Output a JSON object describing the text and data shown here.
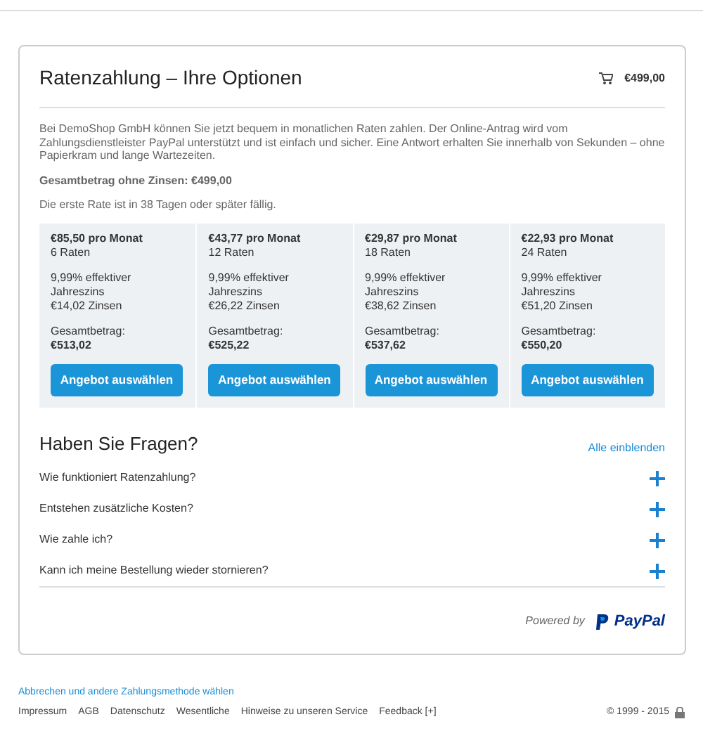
{
  "header": {
    "title": "Ratenzahlung – Ihre Optionen",
    "cart_total": "€499,00"
  },
  "intro": "Bei DemoShop GmbH können Sie jetzt bequem in monatlichen Raten zahlen. Der Online-Antrag wird vom Zahlungsdienstleister PayPal unterstützt und ist einfach und sicher. Eine Antwort erhalten Sie innerhalb von Sekunden – ohne Papierkram und lange Wartezeiten.",
  "total_without_interest": "Gesamtbetrag ohne Zinsen: €499,00",
  "first_rate_note": "Die erste Rate ist in 38 Tagen oder später fällig.",
  "plans": [
    {
      "monthly": "€85,50 pro Monat",
      "count": "6 Raten",
      "rate": "9,99% effektiver Jahreszins",
      "interest": "€14,02 Zinsen",
      "total_label": "Gesamtbetrag:",
      "total": "€513,02",
      "button": "Angebot auswählen"
    },
    {
      "monthly": "€43,77 pro Monat",
      "count": "12 Raten",
      "rate": "9,99% effektiver Jahreszins",
      "interest": "€26,22 Zinsen",
      "total_label": "Gesamtbetrag:",
      "total": "€525,22",
      "button": "Angebot auswählen"
    },
    {
      "monthly": "€29,87 pro Monat",
      "count": "18 Raten",
      "rate": "9,99% effektiver Jahreszins",
      "interest": "€38,62 Zinsen",
      "total_label": "Gesamtbetrag:",
      "total": "€537,62",
      "button": "Angebot auswählen"
    },
    {
      "monthly": "€22,93 pro Monat",
      "count": "24 Raten",
      "rate": "9,99% effektiver Jahreszins",
      "interest": "€51,20 Zinsen",
      "total_label": "Gesamtbetrag:",
      "total": "€550,20",
      "button": "Angebot auswählen"
    }
  ],
  "faq": {
    "title": "Haben Sie Fragen?",
    "show_all": "Alle einblenden",
    "items": [
      {
        "question": "Wie funktioniert Ratenzahlung?",
        "expanded": false
      },
      {
        "question": "Entstehen zusätzliche Kosten?",
        "expanded": false
      },
      {
        "question": "Wie zahle ich?",
        "expanded": false
      },
      {
        "question": "Kann ich meine Bestellung wieder stornieren?",
        "expanded": false
      }
    ]
  },
  "powered_by": {
    "label": "Powered by",
    "brand": "PayPal"
  },
  "cancel_link": "Abbrechen und andere Zahlungsmethode wählen",
  "footer_links": [
    "Impressum",
    "AGB",
    "Datenschutz",
    "Wesentliche",
    "Hinweise zu unseren Service",
    "Feedback [+]"
  ],
  "copyright": "© 1999 - 2015"
}
